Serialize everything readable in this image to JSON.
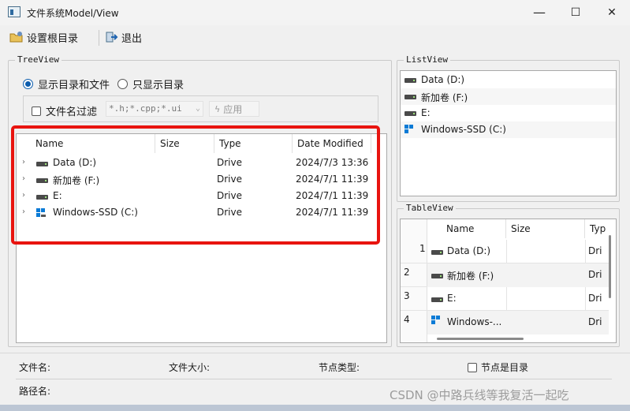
{
  "window": {
    "title": "文件系统Model/View",
    "minimize": "—",
    "maximize": "☐",
    "close": "✕"
  },
  "toolbar": {
    "set_root_label": "设置根目录",
    "exit_label": "退出"
  },
  "treeview_group": {
    "title": "TreeView",
    "radio_all": "显示目录和文件",
    "radio_dirs": "只显示目录",
    "filter_label": "文件名过滤",
    "filter_value": "*.h;*.cpp;*.ui",
    "apply_label": "应用"
  },
  "tree": {
    "headers": [
      "Name",
      "Size",
      "Type",
      "Date Modified"
    ],
    "rows": [
      {
        "name": "Data (D:)",
        "size": "",
        "type": "Drive",
        "modified": "2024/7/3 13:36",
        "icon": "drive-icon"
      },
      {
        "name": "新加卷 (F:)",
        "size": "",
        "type": "Drive",
        "modified": "2024/7/1 11:39",
        "icon": "drive-icon"
      },
      {
        "name": "E:",
        "size": "",
        "type": "Drive",
        "modified": "2024/7/1 11:39",
        "icon": "drive-icon"
      },
      {
        "name": "Windows-SSD (C:)",
        "size": "",
        "type": "Drive",
        "modified": "2024/7/1 11:39",
        "icon": "windows-drive-icon"
      }
    ]
  },
  "listview_group": {
    "title": "ListView",
    "items": [
      "Data (D:)",
      "新加卷 (F:)",
      "E:",
      "Windows-SSD (C:)"
    ]
  },
  "tableview_group": {
    "title": "TableView",
    "headers": [
      "Name",
      "Size",
      "Typ"
    ],
    "rows": [
      {
        "num": "1",
        "name": "Data (D:)",
        "type": "Dri"
      },
      {
        "num": "2",
        "name": "新加卷 (F:)",
        "type": "Dri"
      },
      {
        "num": "3",
        "name": "E:",
        "type": "Dri"
      },
      {
        "num": "4",
        "name": "Windows-...",
        "type": "Dri"
      }
    ]
  },
  "status": {
    "filename_label": "文件名:",
    "filesize_label": "文件大小:",
    "nodetype_label": "节点类型:",
    "is_dir_label": "节点是目录",
    "path_label": "路径名:"
  },
  "watermark": "CSDN @中路兵线等我复活一起吃",
  "colors": {
    "highlight_border": "#e8140f",
    "accent": "#0b5cad"
  }
}
